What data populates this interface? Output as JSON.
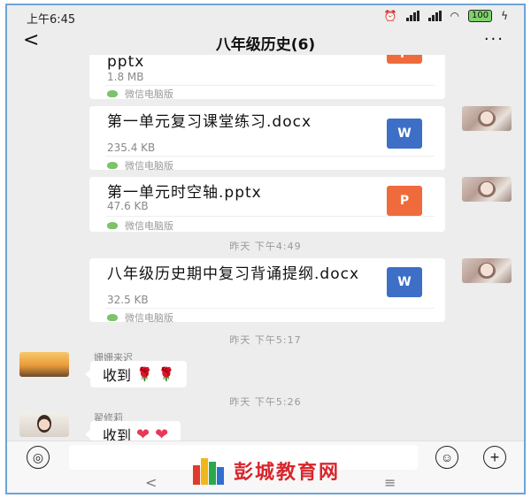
{
  "status_bar": {
    "time": "上午6:45",
    "battery": "100"
  },
  "header": {
    "back_glyph": "<",
    "title": "八年级历史(6)",
    "more_glyph": "···"
  },
  "messages": {
    "file1": {
      "name": "pptx",
      "size": "1.8 MB",
      "source": "微信电脑版",
      "icon_letter": "P"
    },
    "file2": {
      "name": "第一单元复习课堂练习.docx",
      "size": "235.4 KB",
      "source": "微信电脑版",
      "icon_letter": "W"
    },
    "file3": {
      "name": "第一单元时空轴.pptx",
      "size": "47.6 KB",
      "source": "微信电脑版",
      "icon_letter": "P"
    },
    "time1": "昨天 下午4:49",
    "file4": {
      "name": "八年级历史期中复习背诵提纲.docx",
      "size": "32.5 KB",
      "source": "微信电脑版",
      "icon_letter": "W"
    },
    "time2": "昨天 下午5:17",
    "msg1": {
      "sender": "姗姗来迟",
      "text": "收到"
    },
    "time3": "昨天 下午5:26",
    "msg2": {
      "sender": "翟修莉",
      "text": "收到"
    }
  },
  "input_bar": {
    "voice_glyph": "◎",
    "emoji_glyph": "☺",
    "plus_glyph": "+"
  },
  "nav": {
    "back_glyph": "<",
    "menu_glyph": "≡"
  },
  "watermark": {
    "text": "彭城教育网"
  },
  "colors": {
    "ppt": "#ef6b3c",
    "doc": "#3d6fc7",
    "frame": "#6fa3d8"
  }
}
